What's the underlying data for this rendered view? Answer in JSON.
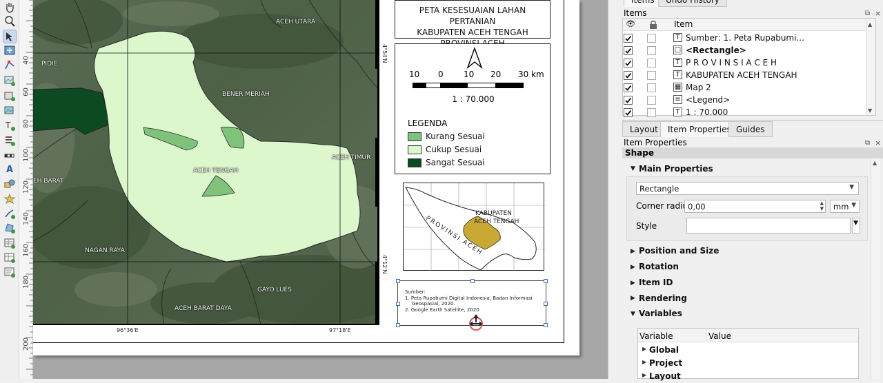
{
  "map": {
    "labels": [
      "ACEH UTARA",
      "PIDIE",
      "BENER MERIAH",
      "ACEH TIMUR",
      "ACEH TENGAH",
      "EH BARAT",
      "NAGAN RAYA",
      "GAYO LUES",
      "ACEH BARAT DAYA"
    ],
    "coords_bottom": [
      "96°36'E",
      "97°18'E"
    ],
    "coords_right": [
      "4°54'N",
      "4°12'N"
    ]
  },
  "ruler_v": [
    "40",
    "60",
    "80",
    "100",
    "120",
    "140",
    "160",
    "180",
    "200"
  ],
  "title_lines": [
    "PETA KESESUAIAN LAHAN PERTANIAN",
    "KABUPATEN ACEH TENGAH",
    "PROVINSI ACEH"
  ],
  "scalebar": {
    "ticks": [
      "10",
      "0",
      "10",
      "20",
      "30 km"
    ],
    "ratio": "1 : 70.000"
  },
  "legend": {
    "title": "LEGENDA",
    "items": [
      {
        "label": "Kurang Sesuai",
        "color": "#7fc27a"
      },
      {
        "label": "Cukup Sesuai",
        "color": "#dcf7cc"
      },
      {
        "label": "Sangat Sesuai",
        "color": "#0c4a22"
      }
    ]
  },
  "inset": {
    "region_label_1": "KABUPATEN",
    "region_label_2": "ACEH TENGAH",
    "province_label": "PROVINSI ACEH"
  },
  "source": {
    "lines": [
      "Sumber:",
      "1. Peta Rupabumi Digital Indonesia, Badan Informasi",
      "Geospasial, 2020.",
      "2. Google Earth Satellite, 2020"
    ]
  },
  "panel": {
    "top_tabs": [
      "Items",
      "Undo History"
    ],
    "items_title": "Items",
    "items_header": "Item",
    "items": [
      {
        "label": "Sumber: 1. Peta Rupabumi...",
        "icon": "T",
        "bold": false
      },
      {
        "label": "<Rectangle>",
        "icon": "□",
        "bold": true
      },
      {
        "label": "P R O V I N S I  A C E H",
        "icon": "T",
        "bold": false
      },
      {
        "label": "KABUPATEN ACEH TENGAH",
        "icon": "T",
        "bold": false
      },
      {
        "label": "Map 2",
        "icon": "▦",
        "bold": false
      },
      {
        "label": "<Legend>",
        "icon": "≡",
        "bold": false
      },
      {
        "label": "1 : 70.000",
        "icon": "T",
        "bold": false
      }
    ],
    "tabs": [
      "Layout",
      "Item Properties",
      "Guides"
    ],
    "props_title": "Item Properties",
    "shape_title": "Shape",
    "main_properties": "Main Properties",
    "shape_value": "Rectangle",
    "corner_radius_label": "Corner radius",
    "corner_radius_value": "0,00",
    "unit_value": "mm",
    "style_label": "Style",
    "sections": [
      "Position and Size",
      "Rotation",
      "Item ID",
      "Rendering"
    ],
    "variables_title": "Variables",
    "var_headers": [
      "Variable",
      "Value"
    ],
    "var_rows": [
      "Global",
      "Project",
      "Layout"
    ]
  }
}
